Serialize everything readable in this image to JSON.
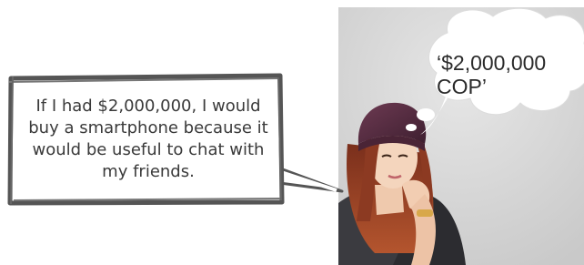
{
  "card": {
    "text": "If I had $2,000,000, I would buy a smartphone because it would be useful to chat with my friends."
  },
  "thought_bubble": {
    "text": "‘$2,000,000 COP’"
  }
}
